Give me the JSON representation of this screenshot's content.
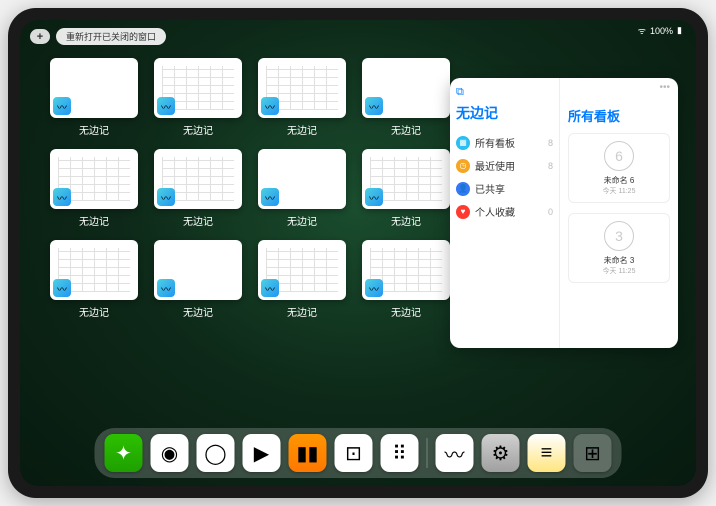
{
  "status": {
    "battery": "100%"
  },
  "topbar": {
    "add": "+",
    "reopen": "重新打开已关闭的窗口"
  },
  "app_name": "无边记",
  "tiles": [
    {
      "label": "无边记",
      "variant": "blank"
    },
    {
      "label": "无边记",
      "variant": "grid"
    },
    {
      "label": "无边记",
      "variant": "grid"
    },
    {
      "label": "无边记",
      "variant": "blank"
    },
    {
      "label": "无边记",
      "variant": "grid"
    },
    {
      "label": "无边记",
      "variant": "grid"
    },
    {
      "label": "无边记",
      "variant": "blank"
    },
    {
      "label": "无边记",
      "variant": "grid"
    },
    {
      "label": "无边记",
      "variant": "grid"
    },
    {
      "label": "无边记",
      "variant": "blank"
    },
    {
      "label": "无边记",
      "variant": "grid"
    },
    {
      "label": "无边记",
      "variant": "grid"
    }
  ],
  "panel": {
    "title": "无边记",
    "right_title": "所有看板",
    "nav": [
      {
        "icon": "grid",
        "color": "#2bbef0",
        "label": "所有看板",
        "count": "8"
      },
      {
        "icon": "clock",
        "color": "#f5a623",
        "label": "最近使用",
        "count": "8"
      },
      {
        "icon": "person",
        "color": "#3478f6",
        "label": "已共享",
        "count": ""
      },
      {
        "icon": "heart",
        "color": "#ff3b30",
        "label": "个人收藏",
        "count": "0"
      }
    ],
    "boards": [
      {
        "sketch": "6",
        "name": "未命名 6",
        "time": "今天 11:25"
      },
      {
        "sketch": "3",
        "name": "未命名 3",
        "time": "今天 11:25"
      }
    ]
  },
  "dock": [
    {
      "name": "wechat-icon",
      "cls": "wechat",
      "glyph": "✦"
    },
    {
      "name": "quark-hd-icon",
      "cls": "quark",
      "glyph": "◉"
    },
    {
      "name": "quark-icon",
      "cls": "quark2",
      "glyph": "◯"
    },
    {
      "name": "play-icon",
      "cls": "play",
      "glyph": "▶"
    },
    {
      "name": "books-icon",
      "cls": "books",
      "glyph": "▮▮"
    },
    {
      "name": "dice-icon",
      "cls": "dice",
      "glyph": "⊡"
    },
    {
      "name": "dots-icon",
      "cls": "dots",
      "glyph": "⠿"
    },
    {
      "name": "freeform-icon",
      "cls": "freeform",
      "glyph": "〰"
    },
    {
      "name": "settings-icon",
      "cls": "settings",
      "glyph": "⚙"
    },
    {
      "name": "notes-icon",
      "cls": "notes",
      "glyph": "≡"
    },
    {
      "name": "app-library-icon",
      "cls": "applib",
      "glyph": "⊞"
    }
  ]
}
